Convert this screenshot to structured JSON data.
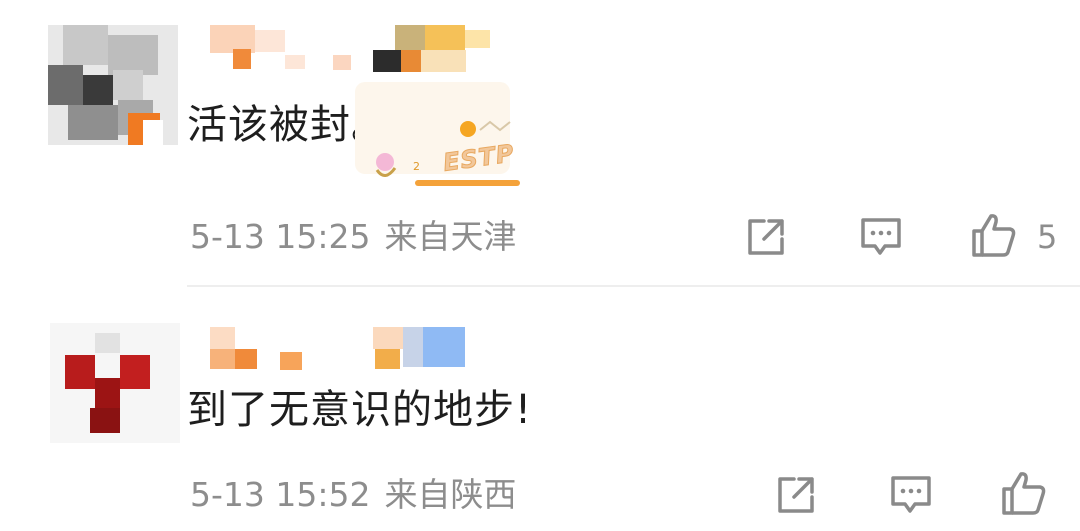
{
  "comments": [
    {
      "text": "活该被封。",
      "time": "5-13 15:25",
      "location": "来自天津",
      "like_count": "5",
      "badge_text": "ESTP"
    },
    {
      "text": "到了无意识的地步!",
      "time": "5-13 15:52",
      "location": "来自陕西",
      "like_count": ""
    }
  ],
  "icons": {
    "share": "share-icon",
    "comment": "comment-icon",
    "like": "thumbs-up-icon"
  },
  "colors": {
    "meta_text": "#8d8d8d",
    "icon": "#8a8a8a",
    "divider": "#eeeeee"
  }
}
